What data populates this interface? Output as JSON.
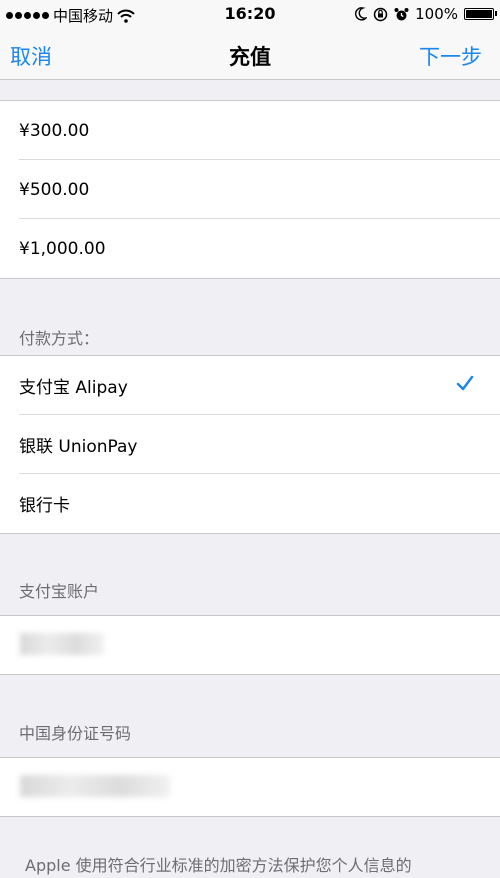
{
  "status_bar": {
    "carrier": "中国移动",
    "time": "16:20",
    "battery": "100%",
    "battery_level": 1.0,
    "icons": [
      "signal-dots-icon",
      "wifi-icon",
      "moon-icon",
      "orientation-lock-icon",
      "alarm-icon",
      "battery-icon"
    ]
  },
  "nav": {
    "cancel": "取消",
    "title": "充值",
    "next": "下一步"
  },
  "amounts": [
    "¥300.00",
    "¥500.00",
    "¥1,000.00"
  ],
  "payment": {
    "header": "付款方式：",
    "options": [
      "支付宝 Alipay",
      "银联 UnionPay",
      "银行卡"
    ],
    "selected": "支付宝 Alipay",
    "check_icon": "checkmark-icon"
  },
  "alipay_account": {
    "header": "支付宝账户"
  },
  "id_number": {
    "header": "中国身份证号码"
  },
  "footer": {
    "text": "Apple 使用符合行业标准的加密方法保护您个人信息的"
  },
  "colors": {
    "accent": "#1a86ee",
    "background": "#efeff4",
    "header_text": "#6d6d72"
  }
}
